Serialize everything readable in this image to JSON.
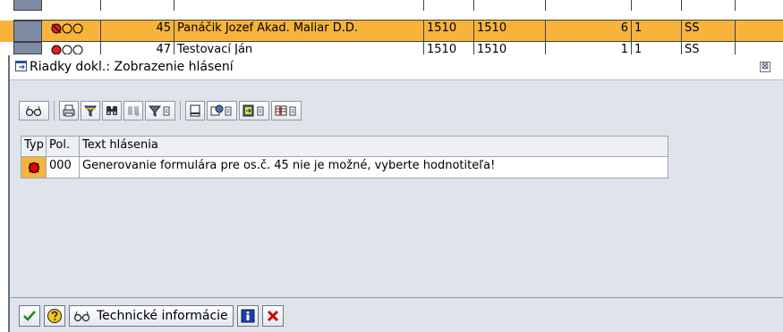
{
  "background_rows": [
    {
      "num": "45",
      "name": "Panáčik Jozef Akad. Maliar D.D.",
      "c1": "1510",
      "c2": "1510",
      "c3": "6",
      "c4": "1",
      "c5": "SS"
    },
    {
      "num": "47",
      "name": "Testovací Ján",
      "c1": "1510",
      "c2": "1510",
      "c3": "1",
      "c4": "1",
      "c5": "SS"
    }
  ],
  "dialog": {
    "title": "Riadky dokl.: Zobrazenie hlásení",
    "close_glyph": "⊠",
    "toolbar": [
      "glasses-icon",
      "print-icon",
      "filter-icon",
      "find-icon",
      "find-next-icon",
      "set-filter-icon",
      "print-preview-icon",
      "export-icon",
      "layout-icon"
    ],
    "table": {
      "headers": {
        "typ": "Typ",
        "pos": "Pol.",
        "text": "Text hlásenia"
      },
      "rows": [
        {
          "type": "error",
          "pos": "000",
          "text": "Generovanie formulára pre os.č. 45 nie je možné, vyberte hodnotiteľa!"
        }
      ]
    },
    "buttons": {
      "tech_info": "Technické informácie"
    }
  },
  "colors": {
    "accent_row": "#f7b33a",
    "dialog_bg": "#dfe4ea",
    "error_red": "#d40000"
  }
}
